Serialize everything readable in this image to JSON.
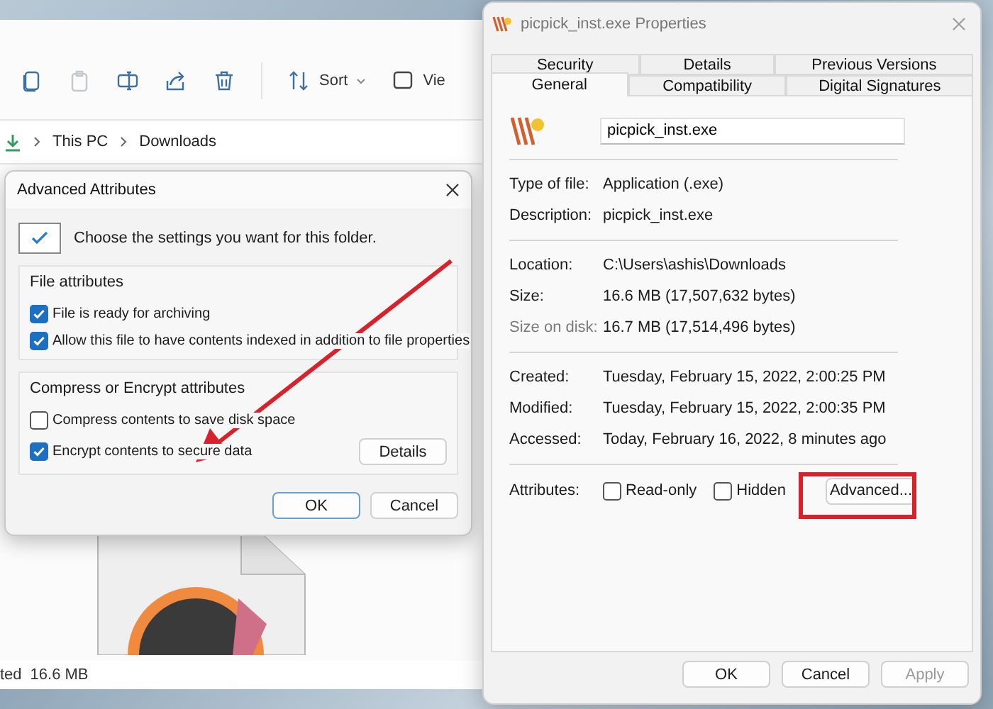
{
  "explorer": {
    "toolbar_icons": [
      {
        "disabled": false
      },
      {
        "disabled": true
      },
      {
        "disabled": false
      },
      {
        "disabled": false
      },
      {
        "disabled": false
      }
    ],
    "sort_label": "Sort",
    "view_label": "Vie",
    "breadcrumb": [
      "This PC",
      "Downloads"
    ],
    "status_bar": {
      "count": "ted",
      "size": "16.6 MB"
    }
  },
  "advanced_dialog": {
    "title": "Advanced Attributes",
    "intro": "Choose the settings you want for this folder.",
    "groups": [
      {
        "title": "File attributes",
        "options": [
          {
            "label": "File is ready for archiving",
            "checked": true
          },
          {
            "label": "Allow this file to have contents indexed in addition to file properties",
            "checked": true
          }
        ]
      },
      {
        "title": "Compress or Encrypt attributes",
        "options": [
          {
            "label": "Compress contents to save disk space",
            "checked": false
          },
          {
            "label": "Encrypt contents to secure data",
            "checked": true
          }
        ],
        "button": "Details"
      }
    ],
    "buttons": [
      "OK",
      "Cancel"
    ]
  },
  "properties": {
    "title": "picpick_inst.exe Properties",
    "tabs_back": [
      {
        "label": "Security",
        "selected": false
      },
      {
        "label": "Details",
        "selected": false
      },
      {
        "label": "Previous Versions",
        "selected": false
      }
    ],
    "tabs_front": [
      {
        "label": "General",
        "selected": true
      },
      {
        "label": "Compatibility",
        "selected": false
      },
      {
        "label": "Digital Signatures",
        "selected": false
      }
    ],
    "file_name": "picpick_inst.exe",
    "sections": [
      [
        {
          "label": "Type of file:",
          "value": "Application (.exe)",
          "dimmed": false
        },
        {
          "label": "Description:",
          "value": "picpick_inst.exe",
          "dimmed": false
        }
      ],
      [
        {
          "label": "Location:",
          "value": "C:\\Users\\ashis\\Downloads",
          "dimmed": false
        },
        {
          "label": "Size:",
          "value": "16.6 MB (17,507,632 bytes)",
          "dimmed": false
        },
        {
          "label": "Size on disk:",
          "value": "16.7 MB (17,514,496 bytes)",
          "dimmed": true
        }
      ],
      [
        {
          "label": "Created:",
          "value": "Tuesday, February 15, 2022, 2:00:25 PM",
          "dimmed": false
        },
        {
          "label": "Modified:",
          "value": "Tuesday, February 15, 2022, 2:00:35 PM",
          "dimmed": false
        },
        {
          "label": "Accessed:",
          "value": "Today, February 16, 2022, 8 minutes ago",
          "dimmed": false
        }
      ]
    ],
    "attributes": {
      "label": "Attributes:",
      "options": [
        {
          "label": "Read-only",
          "checked": false
        },
        {
          "label": "Hidden",
          "checked": false
        }
      ],
      "button": "Advanced..."
    },
    "buttons": [
      {
        "label": "OK",
        "disabled": false
      },
      {
        "label": "Cancel",
        "disabled": false
      },
      {
        "label": "Apply",
        "disabled": true
      }
    ]
  }
}
